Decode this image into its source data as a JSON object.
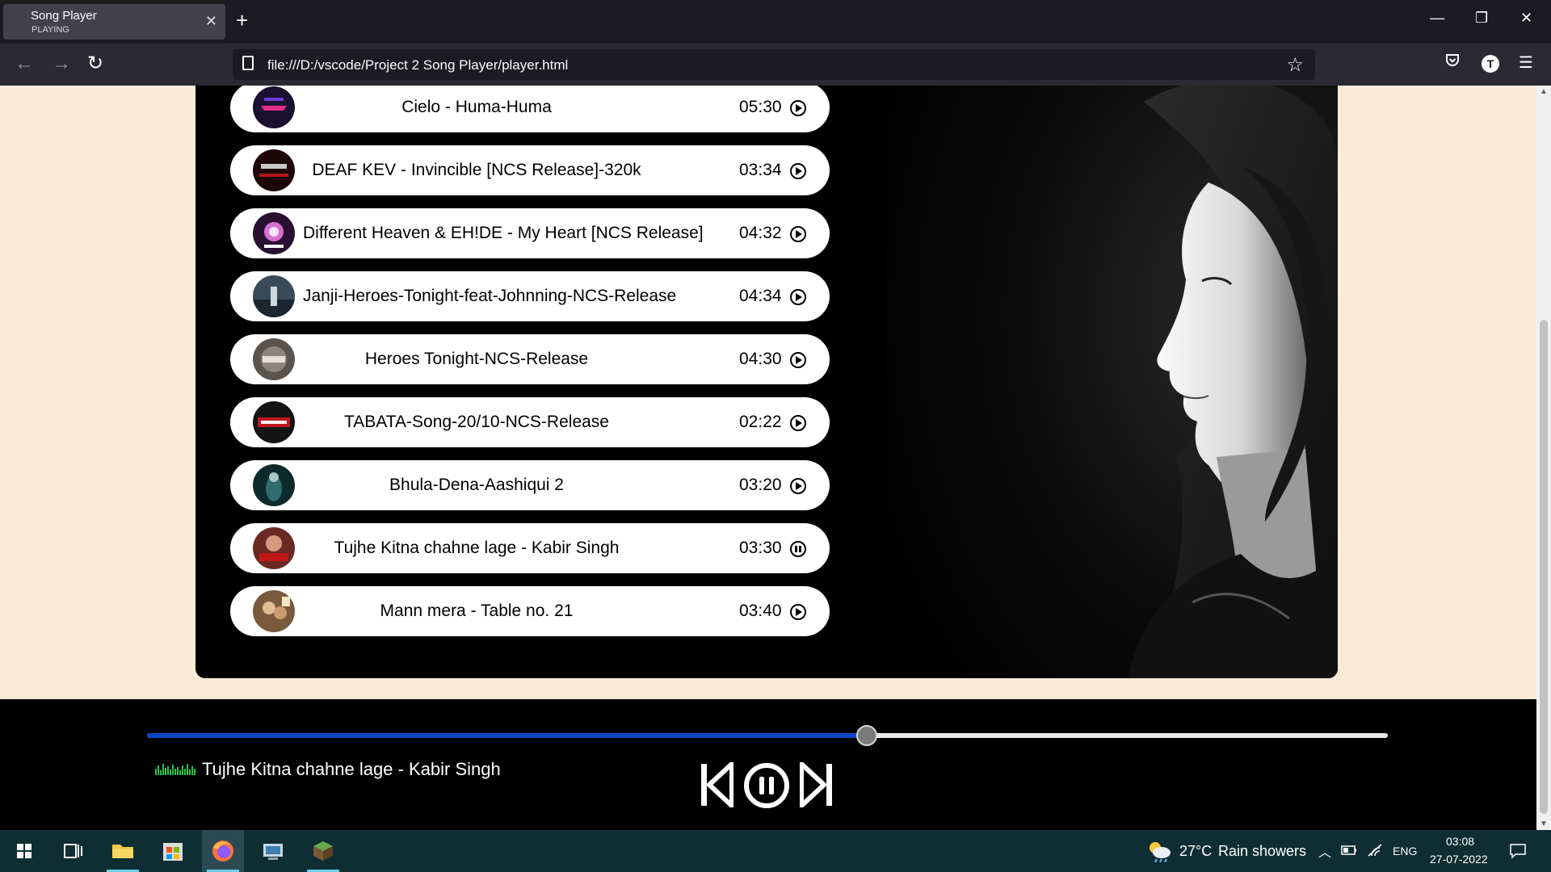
{
  "browser": {
    "tab_title": "Song Player",
    "tab_subtitle": "PLAYING",
    "url": "file:///D:/vscode/Project 2 Song Player/player.html"
  },
  "songs": [
    {
      "name": "Cielo - Huma-Huma",
      "duration": "05:30",
      "state": "play"
    },
    {
      "name": "DEAF KEV - Invincible [NCS Release]-320k",
      "duration": "03:34",
      "state": "play"
    },
    {
      "name": "Different Heaven & EH!DE - My Heart [NCS Release]",
      "duration": "04:32",
      "state": "play"
    },
    {
      "name": "Janji-Heroes-Tonight-feat-Johnning-NCS-Release",
      "duration": "04:34",
      "state": "play"
    },
    {
      "name": "Heroes Tonight-NCS-Release",
      "duration": "04:30",
      "state": "play"
    },
    {
      "name": "TABATA-Song-20/10-NCS-Release",
      "duration": "02:22",
      "state": "play"
    },
    {
      "name": "Bhula-Dena-Aashiqui 2",
      "duration": "03:20",
      "state": "play"
    },
    {
      "name": "Tujhe Kitna chahne lage - Kabir Singh",
      "duration": "03:30",
      "state": "pause"
    },
    {
      "name": "Mann mera - Table no. 21",
      "duration": "03:40",
      "state": "play"
    }
  ],
  "player": {
    "now_playing": "Tujhe Kitna chahne lage - Kabir Singh",
    "progress_percent": 58,
    "progress_color": "#0d47c9"
  },
  "taskbar": {
    "temperature": "27°C",
    "weather": "Rain showers",
    "language": "ENG",
    "time": "03:08",
    "date": "27-07-2022"
  },
  "colors": {
    "page_background": "#faebd7",
    "player_background": "#000000"
  },
  "icons": [
    "back-arrow-icon",
    "forward-arrow-icon",
    "reload-icon",
    "star-icon",
    "pocket-icon",
    "account-icon",
    "menu-icon",
    "play-icon",
    "pause-icon",
    "previous-icon",
    "next-icon",
    "equalizer-icon",
    "windows-start-icon",
    "task-view-icon",
    "weather-icon",
    "notification-icon"
  ]
}
